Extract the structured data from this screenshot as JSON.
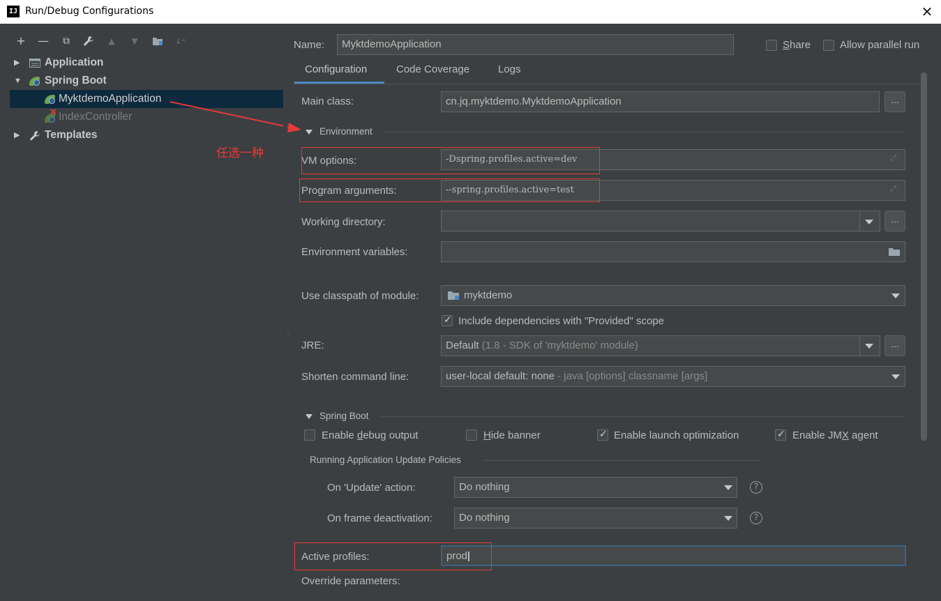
{
  "window": {
    "title": "Run/Debug Configurations",
    "app_icon": "IJ",
    "close_icon": "×"
  },
  "toolbar": {
    "icons": [
      {
        "name": "add-icon",
        "glyph": "+"
      },
      {
        "name": "remove-icon",
        "glyph": "—"
      },
      {
        "name": "copy-icon",
        "glyph": "⧉"
      },
      {
        "name": "wrench-icon",
        "glyph": "🔧"
      },
      {
        "name": "move-up-icon",
        "glyph": "▲"
      },
      {
        "name": "move-down-icon",
        "glyph": "▼"
      },
      {
        "name": "folder-icon",
        "glyph": "▰"
      },
      {
        "name": "sort-icon",
        "glyph": "↓ᵃ"
      }
    ]
  },
  "tree": {
    "application": "Application",
    "spring_boot": "Spring Boot",
    "myktdemo": "MyktdemoApplication",
    "index_controller": "IndexController",
    "templates": "Templates"
  },
  "annotation": {
    "text": "任选一种",
    "color": "#e53a3a"
  },
  "config": {
    "name_label": "Name:",
    "name_value": "MyktdemoApplication",
    "share_label": "Share",
    "allow_parallel_label": "Allow parallel run",
    "tabs": [
      "Configuration",
      "Code Coverage",
      "Logs"
    ],
    "main_class_label": "Main class:",
    "main_class_value": "cn.jq.myktdemo.MyktdemoApplication",
    "environment_section": "Environment",
    "vm_options_label": "VM options:",
    "vm_options_value": "-Dspring.profiles.active=dev",
    "program_args_label": "Program arguments:",
    "program_args_value": "--spring.profiles.active=test",
    "working_dir_label": "Working directory:",
    "working_dir_value": "",
    "env_vars_label": "Environment variables:",
    "env_vars_value": "",
    "classpath_label": "Use classpath of module:",
    "classpath_value": "myktdemo",
    "include_deps_label": "Include dependencies with \"Provided\" scope",
    "include_deps_checked": true,
    "jre_label": "JRE:",
    "jre_value_main": "Default",
    "jre_value_detail": "(1.8 - SDK of 'myktdemo' module)",
    "shorten_label": "Shorten command line:",
    "shorten_value_main": "user-local default: none",
    "shorten_value_detail": "- java [options] classname [args]",
    "spring_boot_section": "Spring Boot",
    "enable_debug_label": "Enable debug output",
    "enable_debug_checked": false,
    "hide_banner_label": "Hide banner",
    "hide_banner_checked": false,
    "launch_opt_label": "Enable launch optimization",
    "launch_opt_checked": true,
    "jmx_label": "Enable JMX agent",
    "jmx_checked": true,
    "policies_section": "Running Application Update Policies",
    "on_update_label": "On 'Update' action:",
    "on_update_value": "Do nothing",
    "on_frame_label": "On frame deactivation:",
    "on_frame_value": "Do nothing",
    "active_profiles_label": "Active profiles:",
    "active_profiles_value": "prod",
    "override_label": "Override parameters:"
  },
  "colors": {
    "background": "#3c3f41",
    "field_bg": "#45494a",
    "selection": "#0d293e",
    "accent_blue": "#4a88c7",
    "annotation_red": "#e53a3a",
    "spring_green": "#6aa84f"
  }
}
